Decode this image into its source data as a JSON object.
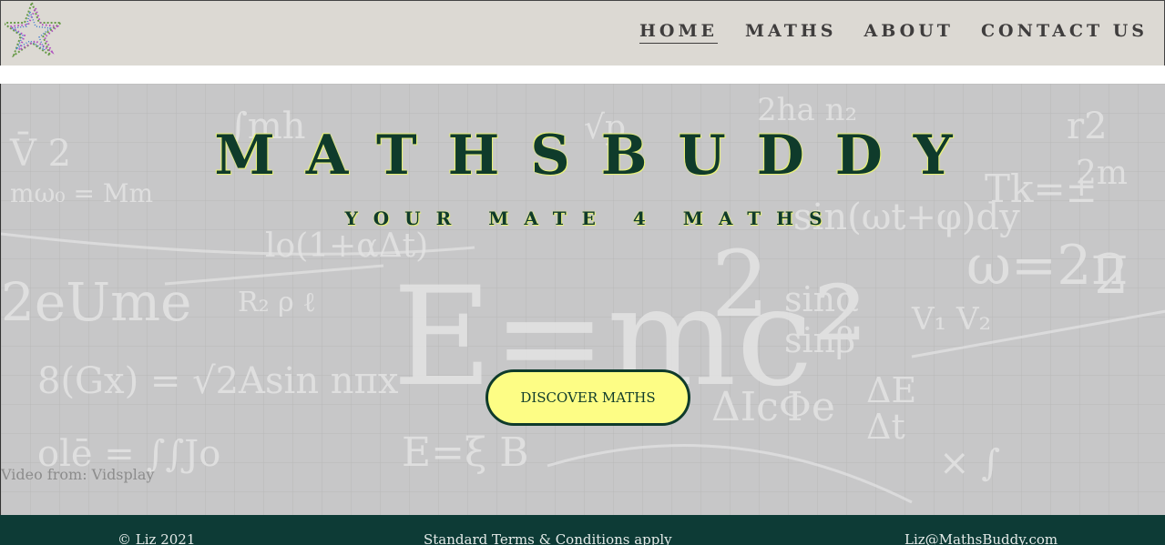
{
  "nav": {
    "logo_icon": "star-logo-icon",
    "links": [
      {
        "label": "HOME",
        "active": true
      },
      {
        "label": "MATHS",
        "active": false
      },
      {
        "label": "ABOUT",
        "active": false
      },
      {
        "label": "CONTACT US",
        "active": false
      }
    ]
  },
  "hero": {
    "title": "MATHSBUDDY",
    "subtitle": "YOUR MATE 4 MATHS",
    "cta_label": "DISCOVER MATHS",
    "video_credit": "Video from: Vidsplay",
    "background_text": [
      "E=mc²",
      "sin(ωt+φ)dy",
      "ΔE",
      "Δt",
      "sinα",
      "sinβ",
      "ω=2π",
      "Tk=±",
      "V₁ V₂",
      "ΔIcΦe"
    ]
  },
  "footer": {
    "copyright": "© Liz 2021",
    "terms": "Standard Terms & Conditions apply",
    "email": "Liz@MathsBuddy.com"
  },
  "colors": {
    "nav_bg": "#dcd9d3",
    "hero_bg": "#c7c7c8",
    "accent_dark": "#0f3b2b",
    "button_bg": "#fdfd85",
    "footer_bg": "#0d3b36"
  }
}
